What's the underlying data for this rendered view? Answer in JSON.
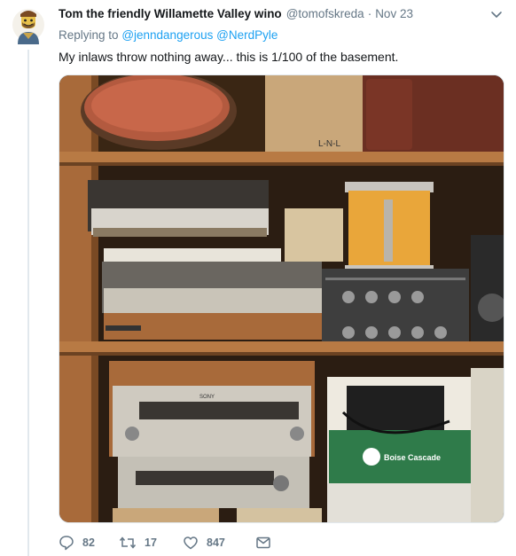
{
  "tweet": {
    "author_name": "Tom the friendly Willamette Valley wino",
    "author_handle": "@tomofskreda",
    "separator": "·",
    "date": "Nov 23",
    "replying_prefix": "Replying to",
    "replying_to": [
      "@jenndangerous",
      "@NerdPyle"
    ],
    "text": "My inlaws throw nothing away...   this is 1/100 of the basement."
  },
  "photo": {
    "box_label": "L-N-L",
    "brand_label": "Boise Cascade",
    "receiver_brand": "SONY"
  },
  "actions": {
    "replies": "82",
    "retweets": "17",
    "likes": "847"
  },
  "icons": {
    "avatar": "lego-minifigure-avatar",
    "caret": "chevron-down-icon",
    "reply": "reply-bubble-icon",
    "retweet": "retweet-icon",
    "like": "heart-icon",
    "dm": "envelope-icon"
  },
  "colors": {
    "link": "#1da1f2",
    "muted": "#657786",
    "text": "#14171a"
  }
}
